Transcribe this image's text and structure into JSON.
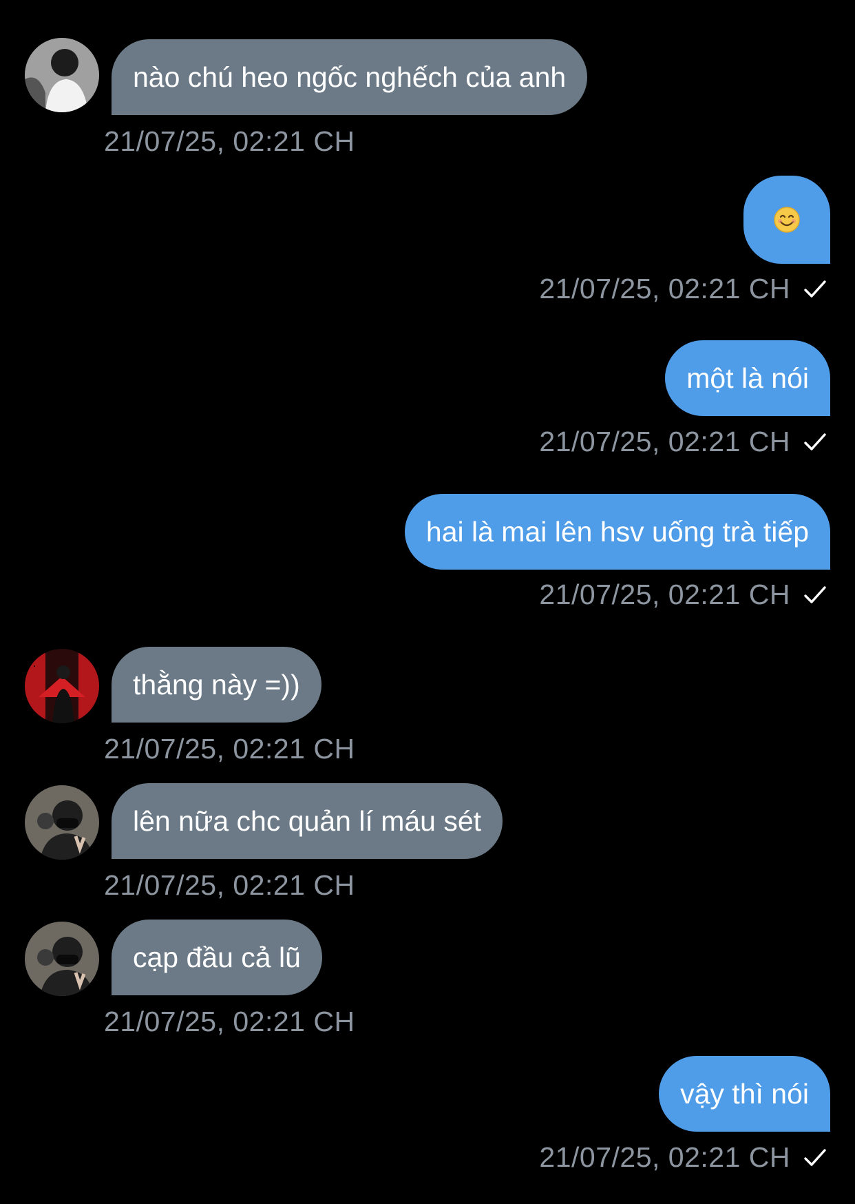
{
  "messages": [
    {
      "direction": "in",
      "text": "nào chú heo ngốc nghếch của anh",
      "time": "21/07/25, 02:21 CH",
      "avatar": "avatar-1"
    },
    {
      "direction": "out",
      "text": "😊",
      "time": "21/07/25, 02:21 CH",
      "icon": "smiling-face-emoji"
    },
    {
      "direction": "out",
      "text": "một là nói",
      "time": "21/07/25, 02:21 CH"
    },
    {
      "direction": "out",
      "text": "hai là mai lên hsv uống trà tiếp",
      "time": "21/07/25, 02:21 CH"
    },
    {
      "direction": "in",
      "text": "thằng này =))",
      "time": "21/07/25, 02:21 CH",
      "avatar": "avatar-2"
    },
    {
      "direction": "in",
      "text": "lên nữa chc quản lí máu sét",
      "time": "21/07/25, 02:21 CH",
      "avatar": "avatar-3"
    },
    {
      "direction": "in",
      "text": "cạp đầu cả lũ",
      "time": "21/07/25, 02:21 CH",
      "avatar": "avatar-3"
    },
    {
      "direction": "out",
      "text": "vậy thì nói",
      "time": "21/07/25, 02:21 CH"
    }
  ],
  "colors": {
    "background": "#000000",
    "incoming_bubble": "#6b7a86",
    "outgoing_bubble": "#4f9ce8",
    "timestamp": "#8d96a0",
    "text": "#ffffff"
  },
  "icons": {
    "read_receipt": "checkmark-icon"
  }
}
